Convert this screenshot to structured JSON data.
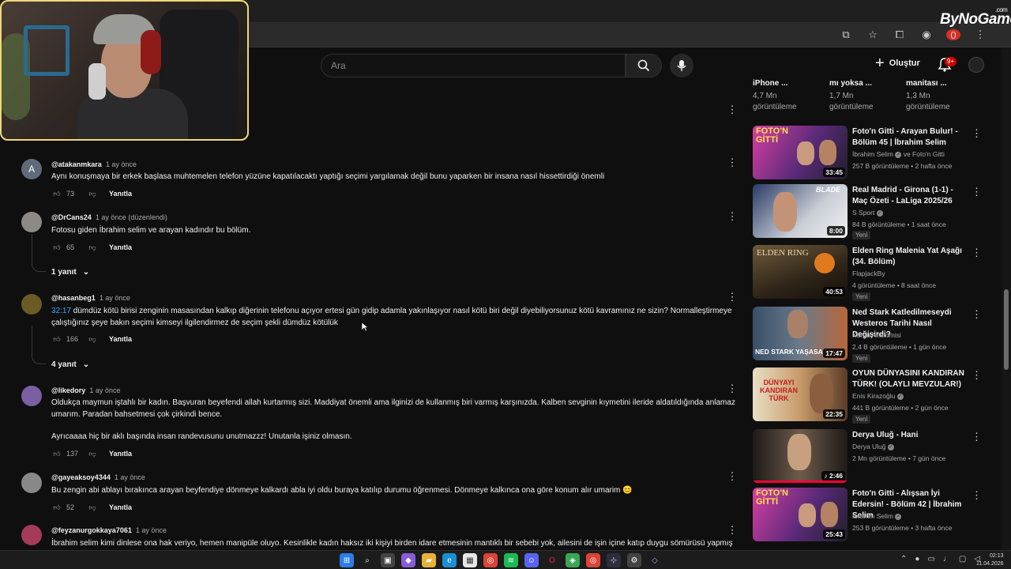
{
  "watermark": {
    "brand": "ByNoGame",
    "suffix": ".com"
  },
  "browser": {
    "extension_badge": "0"
  },
  "header": {
    "search_placeholder": "Ara",
    "create_label": "Oluştur",
    "notif_count": "9+"
  },
  "comments": [
    {
      "author": "@atakanmkara",
      "when": "1 ay önce",
      "avatar_letter": "A",
      "text": "Aynı konuşmaya bir erkek başlasa muhtemelen telefon yüzüne kapatılacaktı yaptığı seçimi yargılamak değil bunu yaparken bir insana nasıl hissettirdiği önemli",
      "likes": "73",
      "reply": "Yanıtla"
    },
    {
      "author": "@DrCans24",
      "when": "1 ay önce (düzenlendi)",
      "text": "Fotosu giden İbrahim selim ve arayan kadındır bu bölüm.",
      "likes": "65",
      "reply": "Yanıtla",
      "replies": "1 yanıt"
    },
    {
      "author": "@hasanbeg1",
      "when": "1 ay önce",
      "timestamp": "32:17",
      "text": " dümdüz kötü birisi zenginin masasından kalkıp diğerinin telefonu açıyor ertesi gün gidip adamla yakınlaşıyor nasıl kötü biri değil diyebiliyorsunuz kötü kavramınız ne sizin? Normalleştirmeye çalıştığınız şeye bakın seçimi kimseyi ilgilendirmez de seçim şekli dümdüz kötülük",
      "likes": "166",
      "reply": "Yanıtla",
      "replies": "4 yanıt"
    },
    {
      "author": "@likedory",
      "when": "1 ay önce",
      "text": "Oldukça maymun iştahlı bir kadın. Başvuran beyefendi allah kurtarmış sizi. Maddiyat önemli ama ilginizi de kullanmış biri varmış karşınızda. Kalben sevginin kıymetini ileride aldatıldığında anlamaz umarım. Paradan bahsetmesi çok çirkindi bence.",
      "text2": "Ayrıcaaaa hiç bir aklı başında insan randevusunu unutmazzz! Unutanla işiniz olmasın.",
      "likes": "137",
      "reply": "Yanıtla"
    },
    {
      "author": "@gayeaksoy4344",
      "when": "1 ay önce",
      "text": "Bu zengin abi ablayı bırakınca arayan beyfendiye dönmeye kalkardı abla iyi oldu buraya katılıp durumu öğrenmesi. Dönmeye kalkınca ona göre konum alır umarim 😊",
      "likes": "52",
      "reply": "Yanıtla"
    },
    {
      "author": "@feyzanurgokkaya7061",
      "when": "1 ay önce",
      "text": "İbrahim selim kimi dinlese ona hak veriyo, hemen manipüle oluyo. Kesinlikle kadın haksız iki kişiyi birden idare etmesinin mantıklı bir sebebi yok, ailesini de işin içine katıp duygu sömürüsü yapmış"
    }
  ],
  "rec_top": [
    {
      "title": "iPhone ...",
      "views": "4,7 Mn",
      "views_label": "görüntüleme"
    },
    {
      "title": "mı yoksa ...",
      "views": "1,7 Mn",
      "views_label": "görüntüleme"
    },
    {
      "title": "manitası ...",
      "views": "1,3 Mn",
      "views_label": "görüntüleme"
    }
  ],
  "recommendations": [
    {
      "title": "Foto'n Gitti - Arayan Bulur! - Bölüm 45 | İbrahim Selim",
      "channel": "İbrahim Selim",
      "channel_extra": "ve Foto'n Gitti",
      "stats": "257 B görüntüleme • 2 hafta önce",
      "duration": "33:45",
      "thumb_caption": "FOTO'N GİTTİ"
    },
    {
      "title": "Real Madrid - Girona (1-1) - Maç Özeti - LaLiga 2025/26",
      "channel": "S Sport",
      "stats": "84 B görüntüleme • 1 saat önce",
      "duration": "8:00",
      "badge": "Yeni",
      "thumb_caption": "BLADE"
    },
    {
      "title": "Elden Ring Malenia Yat Aşağı (34. Bölüm)",
      "channel": "FlapjackBy",
      "stats": "4 görüntüleme • 8 saat önce",
      "duration": "40:53",
      "badge": "Yeni",
      "thumb_caption": "ELDEN RING"
    },
    {
      "title": "Ned Stark Katledilmeseydi Westeros Tarihi Nasıl Değişirdi?",
      "channel": "Kurgu Anatomisi",
      "stats": "2,4 B görüntüleme • 1 gün önce",
      "duration": "17:47",
      "badge": "Yeni",
      "thumb_caption": "NED STARK YAŞASA"
    },
    {
      "title": "OYUN DÜNYASINI KANDIRAN TÜRK! (OLAYLI MEVZULAR!)",
      "channel": "Enis Kirazoğlu",
      "stats": "441 B görüntüleme • 2 gün önce",
      "duration": "22:35",
      "badge": "Yeni",
      "thumb_caption": "DÜNYAYI KANDIRAN TÜRK"
    },
    {
      "title": "Derya Uluğ - Hani",
      "channel": "Derya Uluğ",
      "stats": "2 Mn görüntüleme • 7 gün önce",
      "duration": "2:46"
    },
    {
      "title": "Foto'n Gitti - Alışsan İyi Edersin! - Bölüm 42 | İbrahim Selim",
      "channel": "İbrahim Selim",
      "stats": "253 B görüntüleme • 3 hafta önce",
      "duration": "25:43",
      "thumb_caption": "FOTO'N GİTTİ"
    }
  ],
  "clock": {
    "time": "02:13",
    "date": "11.04.2026"
  }
}
